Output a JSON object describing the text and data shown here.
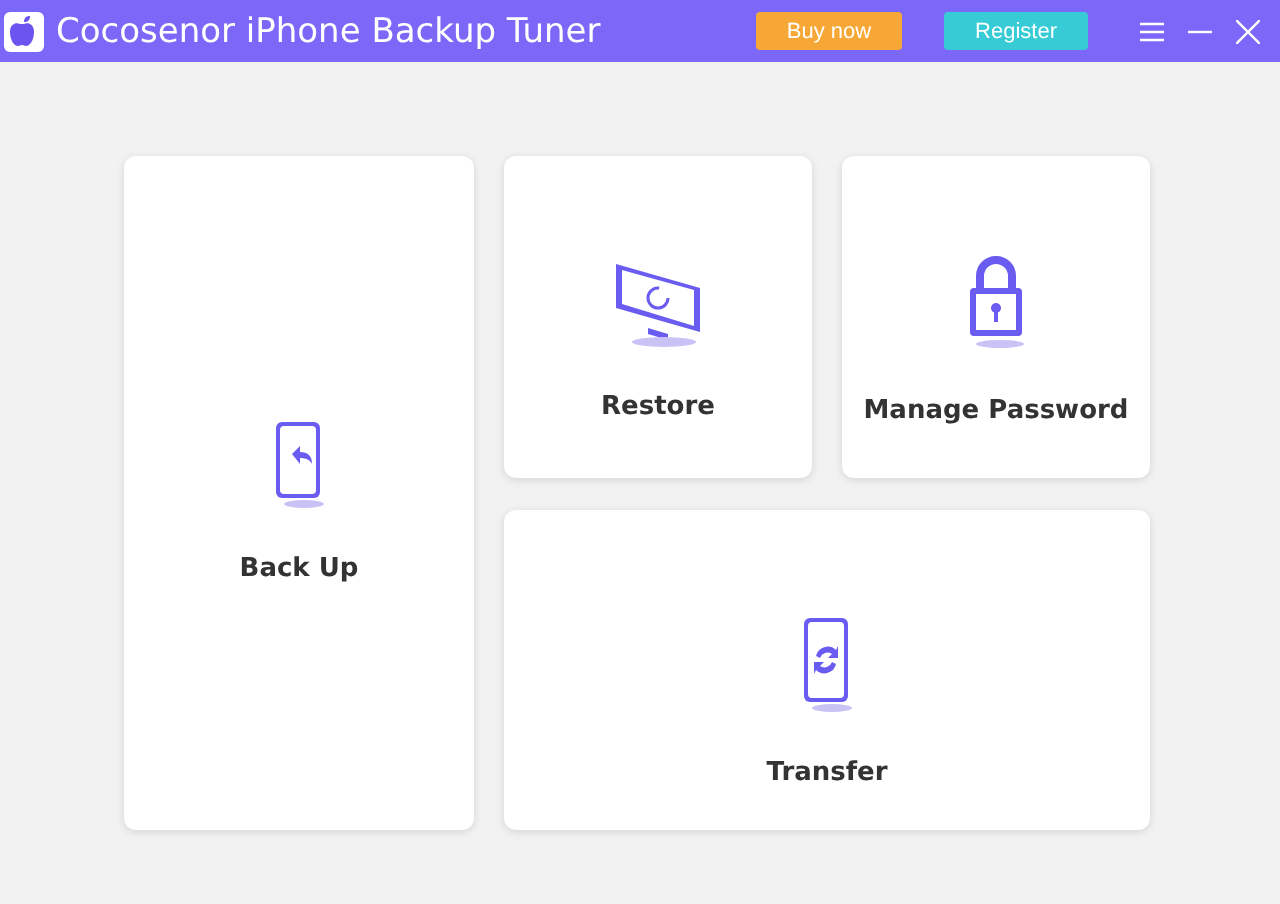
{
  "window": {
    "title": "Cocosenor iPhone Backup Tuner"
  },
  "header_buttons": [
    {
      "label": "Buy now",
      "kind": "buy"
    },
    {
      "label": "Register",
      "kind": "register"
    }
  ],
  "cards": [
    {
      "label": "Back Up",
      "kind": "backup"
    },
    {
      "label": "Restore",
      "kind": "restore"
    },
    {
      "label": "Manage Password",
      "kind": "password"
    },
    {
      "label": "Transfer",
      "kind": "transfer"
    }
  ]
}
